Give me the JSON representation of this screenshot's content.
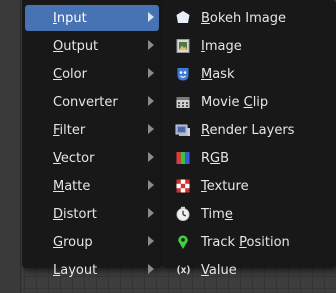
{
  "menu": {
    "items": [
      {
        "label": "Input",
        "active": true
      },
      {
        "label": "Output",
        "active": false
      },
      {
        "label": "Color",
        "active": false
      },
      {
        "label": "Converter",
        "active": false
      },
      {
        "label": "Filter",
        "active": false
      },
      {
        "label": "Vector",
        "active": false
      },
      {
        "label": "Matte",
        "active": false
      },
      {
        "label": "Distort",
        "active": false
      },
      {
        "label": "Group",
        "active": false
      },
      {
        "label": "Layout",
        "active": false
      }
    ]
  },
  "submenu": {
    "items": [
      {
        "label_pre": "",
        "label_ul": "B",
        "label_post": "okeh Image",
        "icon": "bokeh-image-icon"
      },
      {
        "label_pre": "",
        "label_ul": "I",
        "label_post": "mage",
        "icon": "image-icon"
      },
      {
        "label_pre": "",
        "label_ul": "M",
        "label_post": "ask",
        "icon": "mask-icon"
      },
      {
        "label_pre": "Movie ",
        "label_ul": "C",
        "label_post": "lip",
        "icon": "movie-clip-icon"
      },
      {
        "label_pre": "",
        "label_ul": "R",
        "label_post": "ender Layers",
        "icon": "render-layers-icon"
      },
      {
        "label_pre": "R",
        "label_ul": "G",
        "label_post": "B",
        "icon": "rgb-icon"
      },
      {
        "label_pre": "",
        "label_ul": "T",
        "label_post": "exture",
        "icon": "texture-icon"
      },
      {
        "label_pre": "Tim",
        "label_ul": "e",
        "label_post": "",
        "icon": "time-icon"
      },
      {
        "label_pre": "Track ",
        "label_ul": "P",
        "label_post": "osition",
        "icon": "track-position-icon"
      },
      {
        "label_pre": "",
        "label_ul": "V",
        "label_post": "alue",
        "icon": "value-icon"
      }
    ],
    "value_icon_text": "(x)"
  },
  "colors": {
    "active_bg": "#4772b3",
    "menu_bg": "#181818",
    "text": "#e6e6e6"
  }
}
